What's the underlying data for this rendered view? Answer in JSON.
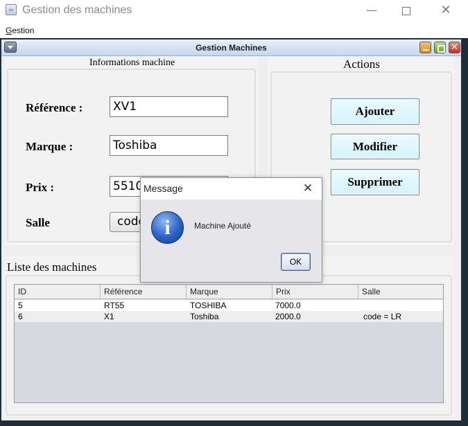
{
  "window": {
    "title": "Gestion des machines",
    "minimize_glyph": "—",
    "close_glyph": "✕"
  },
  "menubar": {
    "gestion_mnemonic": "G",
    "gestion_rest": "estion"
  },
  "internal_frame": {
    "title": "Gestion Machines",
    "close_glyph": "✕"
  },
  "info_panel": {
    "title": "Informations machine",
    "reference_label": "Référence :",
    "marque_label": "Marque :",
    "prix_label": "Prix :",
    "salle_label": "Salle",
    "reference_value": "XV1",
    "marque_value": "Toshiba",
    "prix_value": "5510",
    "salle_value": "code"
  },
  "actions_panel": {
    "title": "Actions",
    "ajouter_label": "Ajouter",
    "modifier_label": "Modifier",
    "supprimer_label": "Supprimer"
  },
  "list_panel": {
    "title": "Liste des machines",
    "columns": [
      "ID",
      "Référence",
      "Marque",
      "Prix",
      "Salle"
    ],
    "rows": [
      [
        "5",
        "RT55",
        "TOSHIBA",
        "7000.0",
        ""
      ],
      [
        "6",
        "X1",
        "Toshiba",
        "2000.0",
        "code = LR"
      ]
    ]
  },
  "dialog": {
    "title": "Message",
    "close_glyph": "✕",
    "icon_glyph": "i",
    "message": "Machine Ajouté",
    "ok_label": "OK"
  },
  "colors": {
    "action_button_bg": "#d4f3fb",
    "desktop_frame": "#1f2c3a",
    "info_icon": "#2a62c5"
  }
}
